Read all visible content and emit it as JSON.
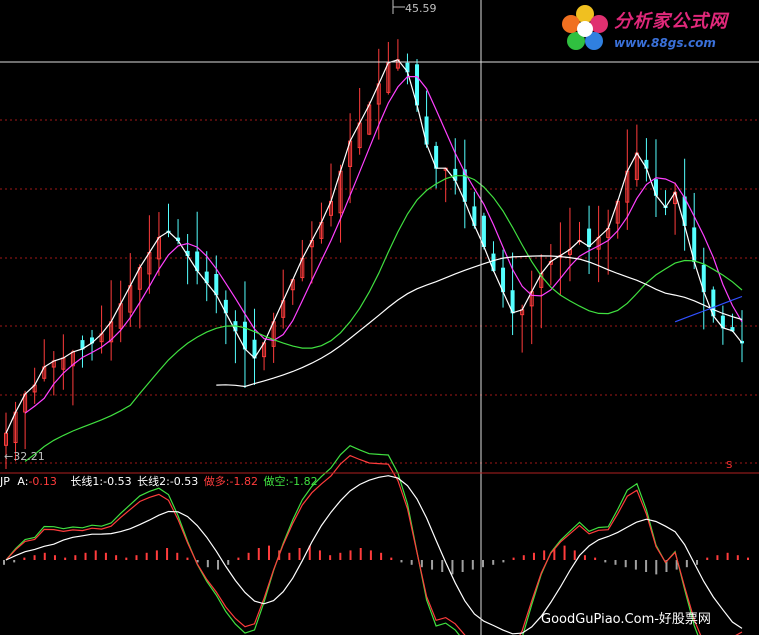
{
  "chart": {
    "price_high_label": "45.59",
    "price_low_label": "32.21",
    "signal_mark": "S"
  },
  "indicator": {
    "name": "JP",
    "a_label": "A:",
    "a_value": "-0.13",
    "long1_label": "长线1:",
    "long1_value": "-0.53",
    "long2_label": "长线2:",
    "long2_value": "-0.53",
    "long_label": "做多:",
    "long_value": "-1.82",
    "short_label": "做空:",
    "short_value": "-1.82"
  },
  "logo": {
    "title": "分析家公式网",
    "url": "www.88gs.com"
  },
  "watermark": "GoodGuPiao.Com-好股票网",
  "colors": {
    "background": "#000000",
    "up_bar": "#ff3c3c",
    "down_bar": "#54ffff",
    "ma_white": "#ffffff",
    "ma_magenta": "#ff40ff",
    "ma_green": "#40e040",
    "ma_blue": "#3050ff",
    "grid": "#a01818",
    "text_red": "#ff3c3c",
    "text_white": "#ffffff",
    "text_green": "#40e040"
  },
  "chart_data": {
    "type": "candlestick",
    "price_high": 45.59,
    "price_low": 32.21,
    "closes": [
      32.6,
      33.3,
      33.9,
      34.2,
      34.8,
      35.0,
      35.1,
      35.3,
      35.4,
      35.6,
      35.9,
      36.3,
      36.9,
      37.5,
      38.1,
      38.6,
      39.1,
      39.3,
      39.0,
      38.5,
      38.0,
      37.6,
      37.2,
      36.6,
      36.0,
      35.4,
      35.1,
      35.6,
      36.3,
      37.0,
      37.7,
      38.4,
      39.0,
      39.6,
      40.3,
      41.3,
      42.3,
      42.9,
      43.5,
      44.2,
      44.9,
      45.0,
      44.6,
      43.5,
      42.2,
      41.4,
      41.4,
      41.0,
      40.3,
      39.5,
      38.8,
      38.0,
      37.3,
      36.6,
      36.7,
      37.3,
      37.9,
      38.3,
      38.5,
      38.7,
      39.0,
      38.8,
      39.1,
      39.4,
      40.3,
      41.3,
      41.9,
      41.4,
      40.5,
      40.1,
      40.6,
      39.5,
      38.3,
      37.3,
      36.5,
      36.1,
      36.0,
      35.6
    ],
    "volume_bars": [
      -0.2,
      -0.1,
      0.1,
      0.2,
      0.3,
      0.2,
      0.1,
      0.2,
      0.3,
      0.4,
      0.3,
      0.2,
      0.1,
      0.2,
      0.3,
      0.4,
      0.5,
      0.3,
      0.1,
      -0.1,
      -0.3,
      -0.4,
      -0.2,
      0.1,
      0.3,
      0.5,
      0.6,
      0.4,
      0.3,
      0.5,
      0.6,
      0.4,
      0.2,
      0.3,
      0.4,
      0.5,
      0.4,
      0.3,
      0.1,
      -0.1,
      -0.2,
      -0.3,
      -0.4,
      -0.5,
      -0.6,
      -0.5,
      -0.4,
      -0.3,
      -0.2,
      -0.1,
      0.1,
      0.2,
      0.3,
      0.4,
      0.5,
      0.6,
      0.4,
      0.2,
      0.1,
      -0.1,
      -0.2,
      -0.3,
      -0.4,
      -0.5,
      -0.6,
      -0.5,
      -0.4,
      -0.3,
      -0.2,
      0.1,
      0.2,
      0.3,
      0.2,
      0.1
    ]
  }
}
